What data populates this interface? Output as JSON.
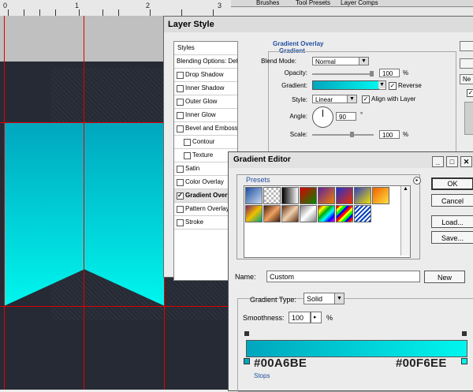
{
  "palette_tabs": [
    "Brushes",
    "Tool Presets",
    "Layer Comps"
  ],
  "ruler_numbers": [
    "0",
    "1",
    "2",
    "3"
  ],
  "layer_style": {
    "title": "Layer Style",
    "styles_header": "Styles",
    "items": [
      {
        "label": "Blending Options: Default",
        "checkbox": false,
        "checked": false,
        "selected": false,
        "indent": false
      },
      {
        "label": "Drop Shadow",
        "checkbox": true,
        "checked": false,
        "selected": false,
        "indent": false
      },
      {
        "label": "Inner Shadow",
        "checkbox": true,
        "checked": false,
        "selected": false,
        "indent": false
      },
      {
        "label": "Outer Glow",
        "checkbox": true,
        "checked": false,
        "selected": false,
        "indent": false
      },
      {
        "label": "Inner Glow",
        "checkbox": true,
        "checked": false,
        "selected": false,
        "indent": false
      },
      {
        "label": "Bevel and Emboss",
        "checkbox": true,
        "checked": false,
        "selected": false,
        "indent": false
      },
      {
        "label": "Contour",
        "checkbox": true,
        "checked": false,
        "selected": false,
        "indent": true
      },
      {
        "label": "Texture",
        "checkbox": true,
        "checked": false,
        "selected": false,
        "indent": true
      },
      {
        "label": "Satin",
        "checkbox": true,
        "checked": false,
        "selected": false,
        "indent": false
      },
      {
        "label": "Color Overlay",
        "checkbox": true,
        "checked": false,
        "selected": false,
        "indent": false
      },
      {
        "label": "Gradient Overlay",
        "checkbox": true,
        "checked": true,
        "selected": true,
        "indent": false
      },
      {
        "label": "Pattern Overlay",
        "checkbox": true,
        "checked": false,
        "selected": false,
        "indent": false
      },
      {
        "label": "Stroke",
        "checkbox": true,
        "checked": false,
        "selected": false,
        "indent": false
      }
    ],
    "gradient_overlay": {
      "group_title": "Gradient Overlay",
      "sub_title": "Gradient",
      "blend_mode_label": "Blend Mode:",
      "blend_mode": "Normal",
      "opacity_label": "Opacity:",
      "opacity": "100",
      "opacity_unit": "%",
      "gradient_label": "Gradient:",
      "reverse_label": "Reverse",
      "reverse_checked": true,
      "style_label": "Style:",
      "style": "Linear",
      "align_label": "Align with Layer",
      "align_checked": true,
      "angle_label": "Angle:",
      "angle": "90",
      "angle_unit": "°",
      "scale_label": "Scale:",
      "scale": "100",
      "scale_unit": "%"
    },
    "side_buttons": [
      "",
      "",
      "Ne"
    ]
  },
  "gradient_editor": {
    "title": "Gradient Editor",
    "window_buttons": [
      "_",
      "□",
      "✕"
    ],
    "presets_label": "Presets",
    "buttons": {
      "ok": "OK",
      "cancel": "Cancel",
      "load": "Load...",
      "save": "Save..."
    },
    "name_label": "Name:",
    "name_value": "Custom",
    "new_button": "New",
    "gradient_type_label": "Gradient Type:",
    "gradient_type": "Solid",
    "smoothness_label": "Smoothness:",
    "smoothness": "100",
    "smoothness_unit": "%",
    "start_color": "#00A6BE",
    "end_color": "#00F6EE",
    "stops_label": "Stops"
  }
}
